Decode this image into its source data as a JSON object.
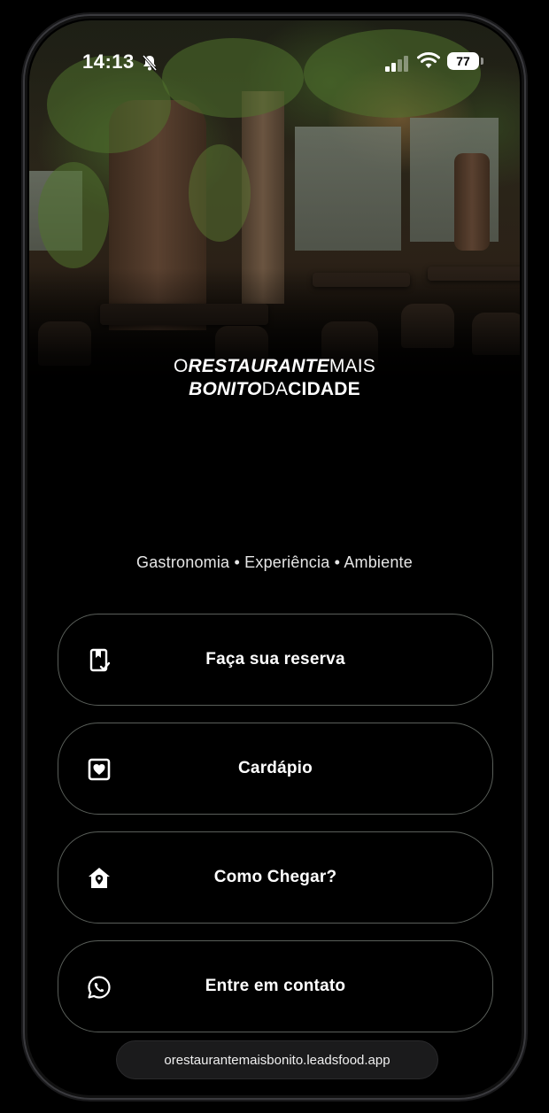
{
  "status_bar": {
    "time": "14:13",
    "battery": "77"
  },
  "logo": {
    "line1_thin_a": "O",
    "line1_bold": "RESTAURANTE",
    "line1_thin_b": "MAIS",
    "line2_bold": "BONITO",
    "line2_thin": "DA",
    "line2_bold_b": "CIDADE"
  },
  "tagline": "Gastronomia • Experiência • Ambiente",
  "buttons": [
    {
      "label": "Faça sua reserva",
      "icon": "reservation-icon"
    },
    {
      "label": "Cardápio",
      "icon": "menu-heart-icon"
    },
    {
      "label": "Como Chegar?",
      "icon": "location-home-icon"
    },
    {
      "label": "Entre em contato",
      "icon": "whatsapp-icon"
    }
  ],
  "url": "orestaurantemaisbonito.leadsfood.app"
}
